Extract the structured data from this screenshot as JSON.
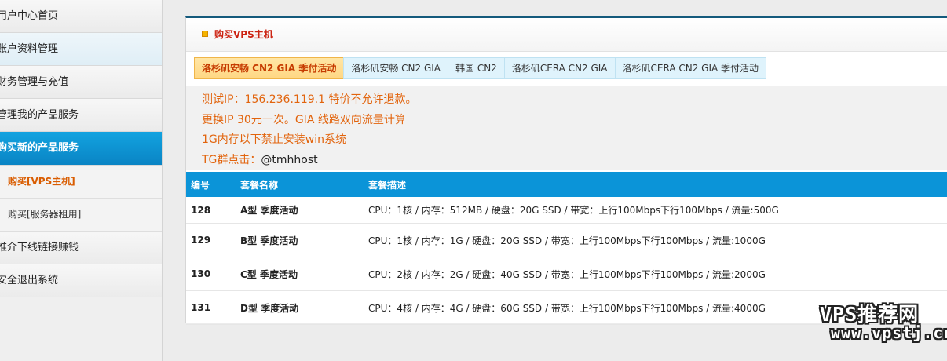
{
  "sidebar": {
    "items": [
      {
        "label": "用户中心首页"
      },
      {
        "label": "账户资料管理"
      },
      {
        "label": "财务管理与充值"
      },
      {
        "label": "管理我的产品服务"
      },
      {
        "label": "购买新的产品服务"
      }
    ],
    "subitems": [
      {
        "label": "购买[VPS主机]"
      },
      {
        "label": "购买[服务器租用]"
      }
    ],
    "items_after": [
      {
        "label": "推介下线链接赚钱"
      },
      {
        "label": "安全退出系统"
      }
    ]
  },
  "panel": {
    "title": "购买VPS主机",
    "tabs": [
      {
        "label": "洛杉矶安畅 CN2 GIA 季付活动"
      },
      {
        "label": "洛杉矶安畅 CN2 GIA"
      },
      {
        "label": "韩国 CN2"
      },
      {
        "label": "洛杉矶CERA CN2 GIA"
      },
      {
        "label": "洛杉矶CERA CN2 GIA 季付活动"
      }
    ],
    "notice": {
      "line1": "测试IP：156.236.119.1 特价不允许退款。",
      "line2": "更换IP 30元一次。GIA 线路双向流量计算",
      "line3": "1G内存以下禁止安装win系统",
      "line4_prefix": "TG群点击：",
      "line4_handle": "@tmhhost"
    },
    "table": {
      "headers": [
        "编号",
        "套餐名称",
        "套餐描述"
      ],
      "rows": [
        {
          "id": "128",
          "name": "A型 季度活动",
          "desc": "CPU：1核 / 内存：512MB / 硬盘：20G SSD / 带宽：上行100Mbps下行100Mbps / 流量:500G"
        },
        {
          "id": "129",
          "name": "B型 季度活动",
          "desc": "CPU：1核 / 内存：1G / 硬盘：20G SSD / 带宽：上行100Mbps下行100Mbps / 流量:1000G"
        },
        {
          "id": "130",
          "name": "C型 季度活动",
          "desc": "CPU：2核 / 内存：2G / 硬盘：40G SSD / 带宽：上行100Mbps下行100Mbps / 流量:2000G"
        },
        {
          "id": "131",
          "name": "D型 季度活动",
          "desc": "CPU：4核 / 内存：4G / 硬盘：60G SSD / 带宽：上行100Mbps下行100Mbps / 流量:4000G"
        }
      ]
    }
  },
  "watermark": {
    "line1": "VPS推荐网",
    "line2": "www.vpstj.cn"
  },
  "colors": {
    "accent": "#0b94d8",
    "active_tab": "#ffd783",
    "notice_text": "#e2640d"
  }
}
